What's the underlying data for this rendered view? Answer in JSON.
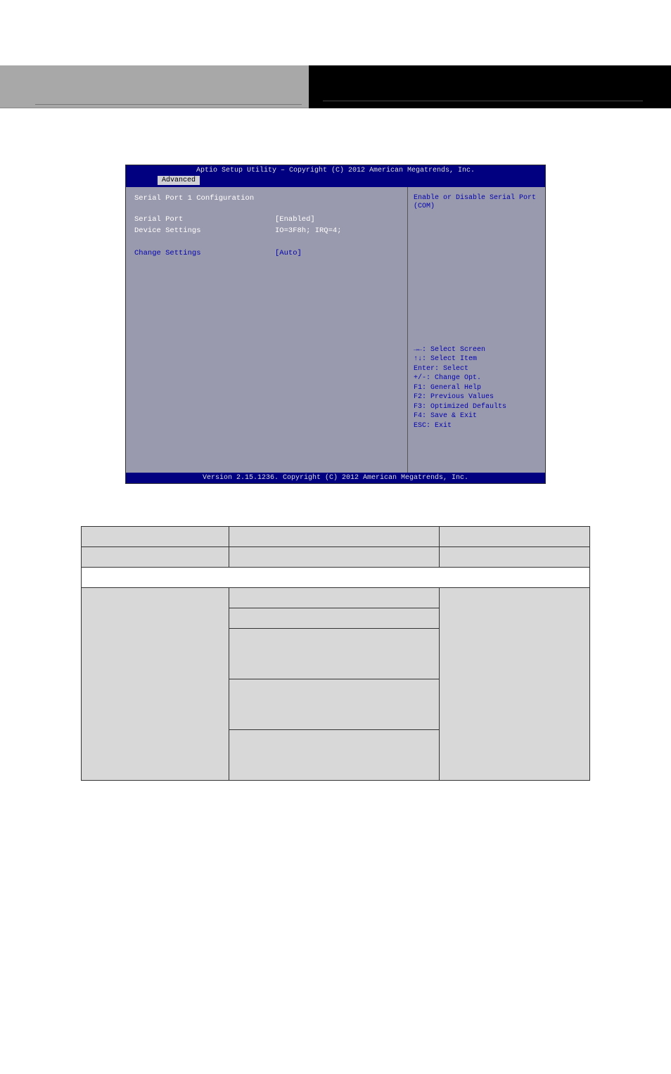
{
  "header": {
    "left_text": "",
    "right_text": ""
  },
  "bios": {
    "title": "Aptio Setup Utility – Copyright (C) 2012 American Megatrends, Inc.",
    "tab": "Advanced",
    "section_title": "Serial Port 1 Configuration",
    "rows": [
      {
        "label": "Serial Port",
        "value": "[Enabled]",
        "style": "white"
      },
      {
        "label": "Device Settings",
        "value": "IO=3F8h; IRQ=4;",
        "style": "white"
      },
      {
        "label": "Change Settings",
        "value": "[Auto]",
        "style": "blue"
      }
    ],
    "help_text": "Enable or Disable Serial Port (COM)",
    "keys": [
      "→←: Select Screen",
      "↑↓: Select Item",
      "Enter: Select",
      "+/-: Change Opt.",
      "F1: General Help",
      "F2: Previous Values",
      "F3: Optimized Defaults",
      "F4: Save & Exit",
      "ESC: Exit"
    ],
    "footer": "Version 2.15.1236. Copyright (C) 2012 American Megatrends, Inc."
  },
  "table": {
    "header": {
      "c1": "",
      "c2": "",
      "c3": ""
    },
    "row2": {
      "c2": "",
      "c3": ""
    },
    "merged_row": "",
    "options": [
      {
        "c2": "",
        "c3": ""
      },
      {
        "c2": "",
        "c3": ""
      },
      {
        "c2": "",
        "c3": ""
      },
      {
        "c2": "",
        "c3": ""
      },
      {
        "c2": "",
        "c3": ""
      }
    ]
  }
}
